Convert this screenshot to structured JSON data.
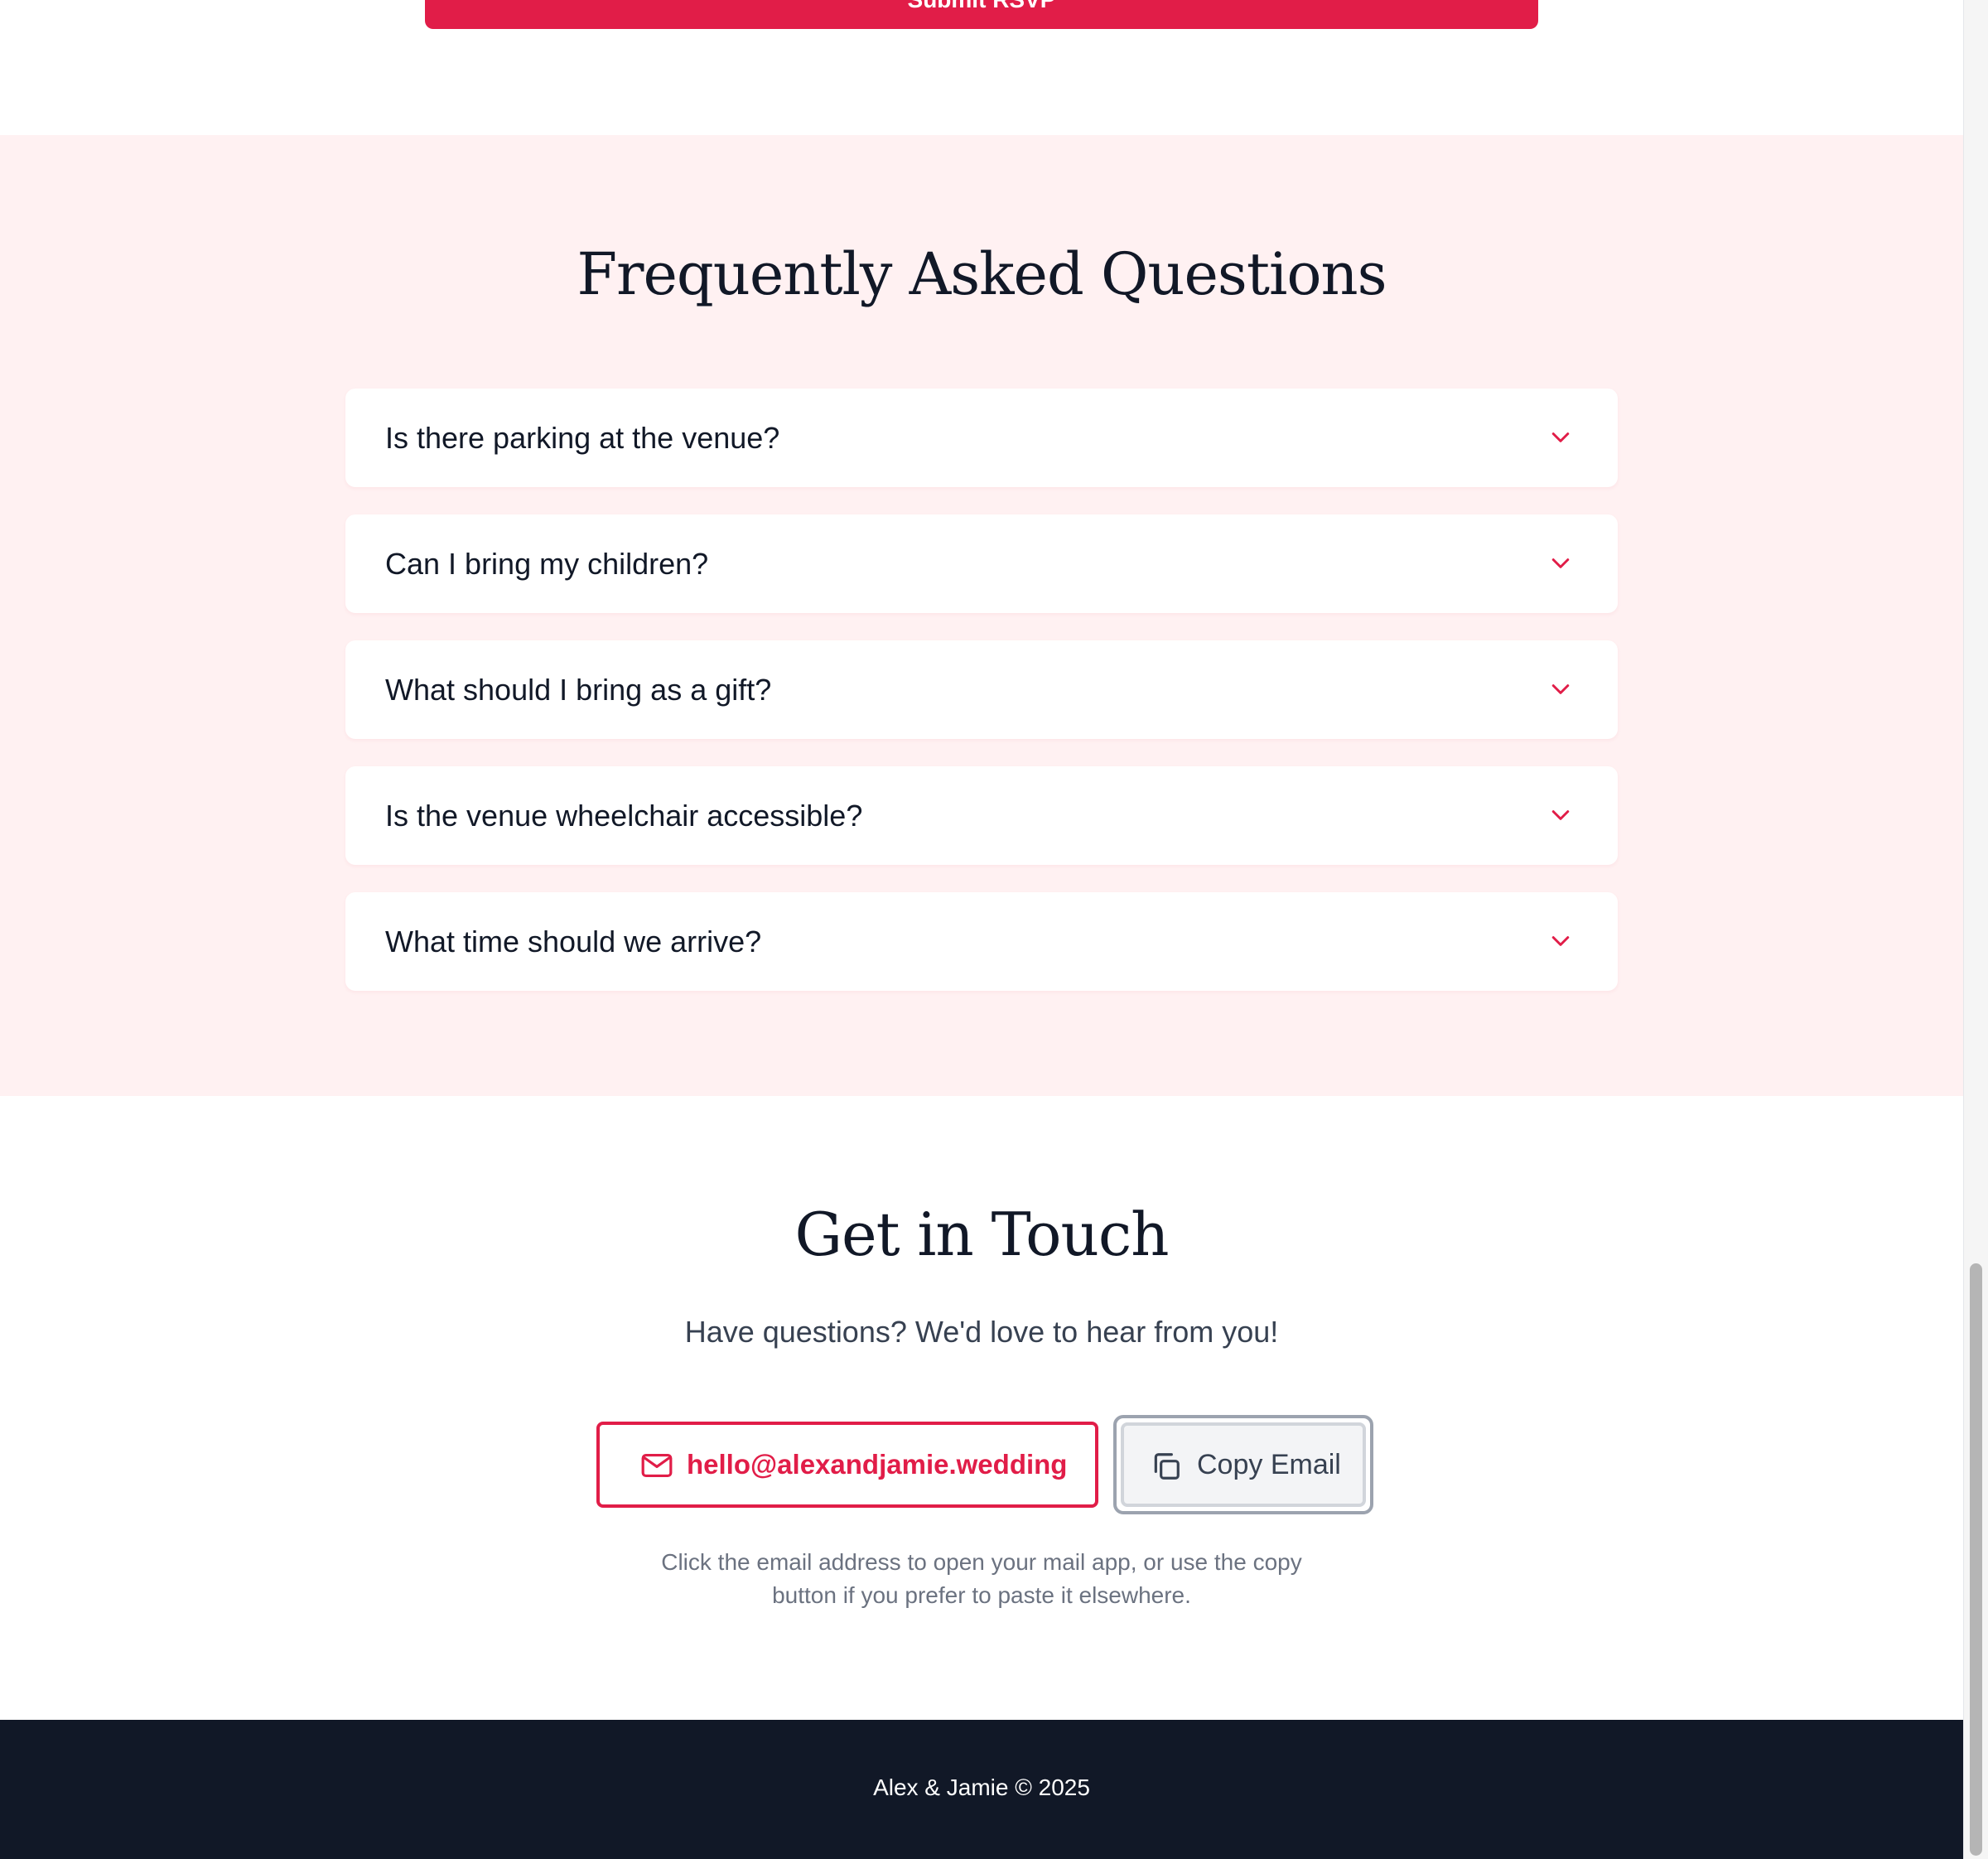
{
  "rsvp": {
    "submit_label": "Submit RSVP"
  },
  "faq": {
    "title": "Frequently Asked Questions",
    "items": [
      {
        "question": "Is there parking at the venue?"
      },
      {
        "question": "Can I bring my children?"
      },
      {
        "question": "What should I bring as a gift?"
      },
      {
        "question": "Is the venue wheelchair accessible?"
      },
      {
        "question": "What time should we arrive?"
      }
    ],
    "chevron_icon": "chevron-down-icon"
  },
  "contact": {
    "title": "Get in Touch",
    "subtitle": "Have questions? We'd love to hear from you!",
    "email": "hello@alexandjamie.wedding",
    "email_icon": "mail-icon",
    "copy_label": "Copy Email",
    "copy_icon": "copy-icon",
    "note": "Click the email address to open your mail app, or use the copy button if you prefer to paste it elsewhere."
  },
  "footer": {
    "text": "Alex & Jamie © 2025"
  },
  "colors": {
    "accent": "#e11d48",
    "faq_background": "#fff1f2",
    "footer_background": "#111827",
    "heading_text": "#111827",
    "muted_text": "#6b7280"
  }
}
